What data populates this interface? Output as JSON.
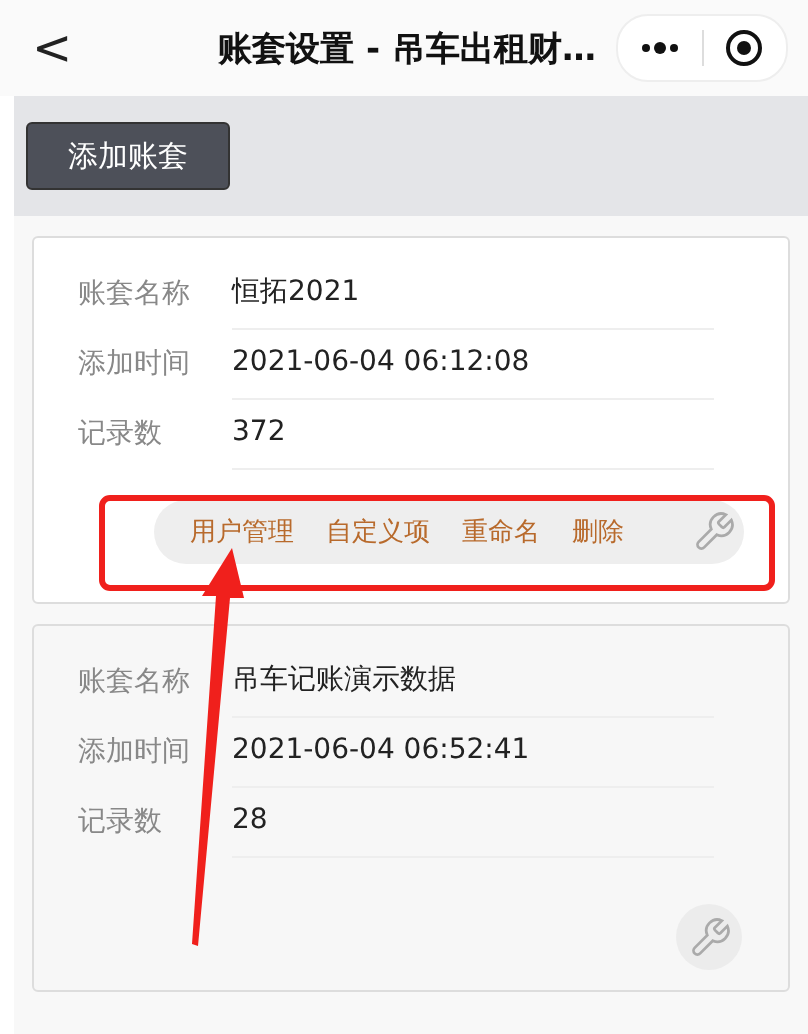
{
  "nav": {
    "back": "<",
    "title": "账套设置 - 吊车出租财…"
  },
  "toolbar": {
    "add_button": "添加账套"
  },
  "accounts": [
    {
      "fields": [
        {
          "label": "账套名称",
          "value": "恒拓2021"
        },
        {
          "label": "添加时间",
          "value": "2021-06-04 06:12:08"
        },
        {
          "label": "记录数",
          "value": "372"
        }
      ],
      "expanded": true,
      "actions": [
        "用户管理",
        "自定义项",
        "重命名",
        "删除"
      ]
    },
    {
      "fields": [
        {
          "label": "账套名称",
          "value": "吊车记账演示数据"
        },
        {
          "label": "添加时间",
          "value": "2021-06-04 06:52:41"
        },
        {
          "label": "记录数",
          "value": "28"
        }
      ],
      "expanded": false
    }
  ]
}
